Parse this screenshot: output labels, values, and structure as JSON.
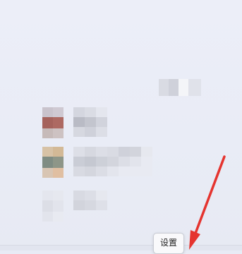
{
  "tooltip": {
    "label": "设置"
  },
  "icons": {
    "settings_target": "gear-icon",
    "annotation": "red-arrow-icon"
  },
  "colors": {
    "background": "#e9ecf6",
    "arrow": "#e5342f",
    "tooltip_bg": "#f9f9fb"
  }
}
